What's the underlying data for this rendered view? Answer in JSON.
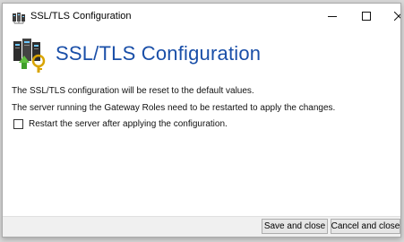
{
  "window": {
    "title": "SSL/TLS Configuration",
    "icon": "network-servers-icon",
    "controls": {
      "minimize": "minimize-icon",
      "maximize": "maximize-icon",
      "close": "close-icon"
    }
  },
  "header": {
    "title": "SSL/TLS Configuration",
    "icon": "server-key-icon"
  },
  "body": {
    "line1": "The SSL/TLS configuration will be reset to the default values.",
    "line2": "The server running the Gateway Roles need to be restarted to apply the changes.",
    "restart_checkbox": {
      "label": "Restart the server after applying the configuration.",
      "checked": false
    }
  },
  "footer": {
    "save_label": "Save and close",
    "cancel_label": "Cancel and close"
  },
  "colors": {
    "header_title": "#1a4fa8",
    "window_bg": "#ffffff",
    "footer_bg": "#f0f0f0"
  }
}
